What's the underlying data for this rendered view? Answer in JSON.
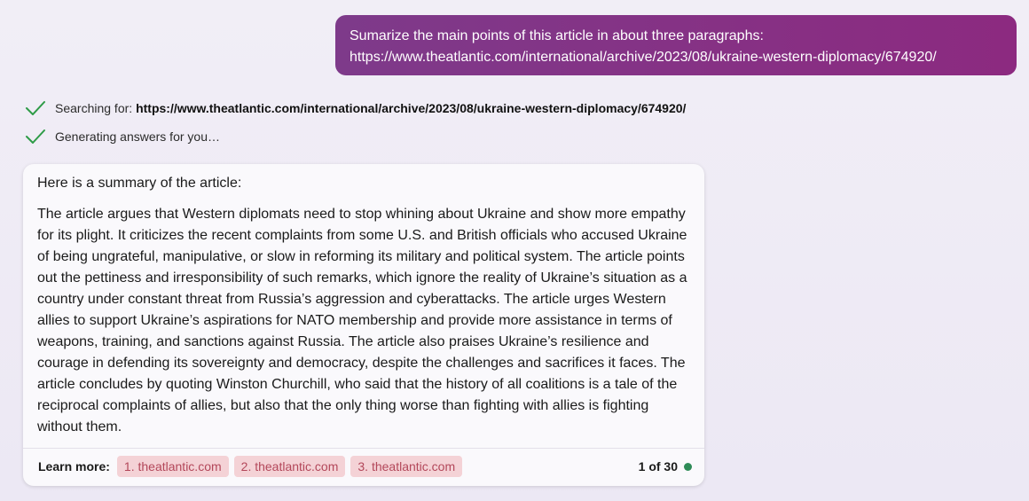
{
  "user_message": {
    "line1": "Sumarize the main points of this article in about three paragraphs:",
    "line2": "https://www.theatlantic.com/international/archive/2023/08/ukraine-western-diplomacy/674920/"
  },
  "status": {
    "searching_prefix": "Searching for: ",
    "searching_query": "https://www.theatlantic.com/international/archive/2023/08/ukraine-western-diplomacy/674920/",
    "generating": "Generating answers for you…",
    "check_icon": "checkmark-icon",
    "check_color": "#2e9b47"
  },
  "answer": {
    "intro": "Here is a summary of the article:",
    "body": "The article argues that Western diplomats need to stop whining about Ukraine and show more empathy for its plight. It criticizes the recent complaints from some U.S. and British officials who accused Ukraine of being ungrateful, manipulative, or slow in reforming its military and political system. The article points out the pettiness and irresponsibility of such remarks, which ignore the reality of Ukraine’s situation as a country under constant threat from Russia’s aggression and cyberattacks. The article urges Western allies to support Ukraine’s aspirations for NATO membership and provide more assistance in terms of weapons, training, and sanctions against Russia. The article also praises Ukraine’s resilience and courage in defending its sovereignty and democracy, despite the challenges and sacrifices it faces. The article concludes by quoting Winston Churchill, who said that the history of all coalitions is a tale of the reciprocal complaints of allies, but also that the only thing worse than fighting with allies is fighting without them."
  },
  "footer": {
    "learn_more_label": "Learn more:",
    "sources": [
      {
        "label": "1. theatlantic.com"
      },
      {
        "label": "2. theatlantic.com"
      },
      {
        "label": "3. theatlantic.com"
      }
    ],
    "counter": "1 of 30",
    "status_dot_color": "#2e8b57"
  },
  "colors": {
    "user_bubble_start": "#7e3a8a",
    "user_bubble_end": "#8c2a80",
    "chip_background": "#f4d2d6",
    "chip_text": "#b3475a"
  }
}
